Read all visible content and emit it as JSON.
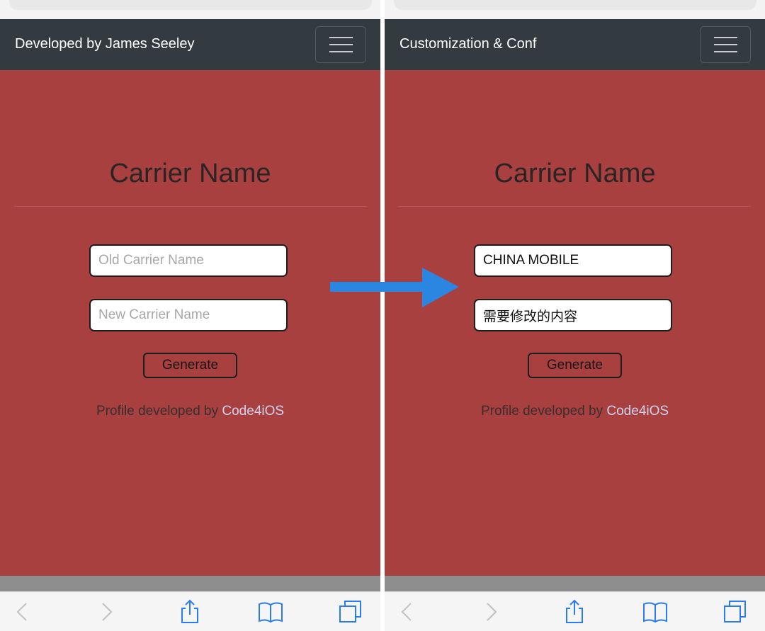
{
  "left": {
    "brand": "Developed by James Seeley",
    "heading": "Carrier Name",
    "old_field": {
      "placeholder": "Old Carrier Name",
      "value": ""
    },
    "new_field": {
      "placeholder": "New Carrier Name",
      "value": ""
    },
    "generate_label": "Generate",
    "credit_prefix": "Profile developed by",
    "credit_link": "Code4iOS"
  },
  "right": {
    "brand": "Customization & Conf",
    "heading": "Carrier Name",
    "old_field": {
      "placeholder": "Old Carrier Name",
      "value": "CHINA MOBILE"
    },
    "new_field": {
      "placeholder": "New Carrier Name",
      "value": "需要修改的内容"
    },
    "generate_label": "Generate",
    "credit_prefix": "Profile developed by",
    "credit_link": "Code4iOS"
  },
  "icons": {
    "menu": "hamburger-icon",
    "back": "chevron-left-icon",
    "forward": "chevron-right-icon",
    "share": "share-icon",
    "bookmarks": "book-icon",
    "tabs": "tabs-icon",
    "transition": "arrow-right-icon"
  },
  "colors": {
    "page_background": "#a94040",
    "navbar": "#333a40",
    "link": "#cfd3f0",
    "arrow": "#2a86e0",
    "toolbar_icon": "#2a7cf0",
    "toolbar_icon_disabled": "#c4c4c4"
  }
}
